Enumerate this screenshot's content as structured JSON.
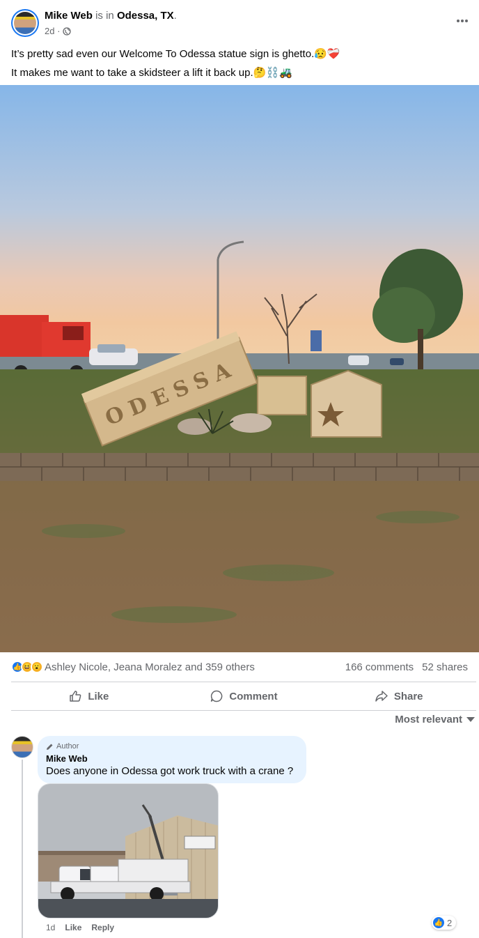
{
  "post": {
    "author": "Mike Web",
    "is_in": "is in",
    "location": "Odessa, TX",
    "period": ".",
    "time": "2d ·",
    "privacy_icon": "globe-icon",
    "text_line1": "It’s pretty sad even our Welcome To Odessa statue sign is ghetto.😥❤️‍🩹",
    "text_line2": "It makes me want to take a skidsteer a lift it back up.🤔⛓️🚜",
    "image_sign_text": "ODESSA"
  },
  "reactions": {
    "icons": [
      "like-icon",
      "haha-icon",
      "wow-icon"
    ],
    "reactors": "Ashley Nicole, Jeana Moralez and 359 others",
    "comments": "166 comments",
    "shares": "52 shares"
  },
  "actions": {
    "like": "Like",
    "comment": "Comment",
    "share": "Share"
  },
  "sort": {
    "label": "Most relevant"
  },
  "comment": {
    "badge": "Author",
    "name": "Mike Web",
    "text": "Does anyone in Odessa got work truck with a crane ?",
    "time": "1d",
    "like": "Like",
    "reply": "Reply",
    "reaction_count": "2"
  },
  "colors": {
    "brand": "#1877f2",
    "secondary_text": "#65676b",
    "bubble": "#e7f3ff"
  }
}
